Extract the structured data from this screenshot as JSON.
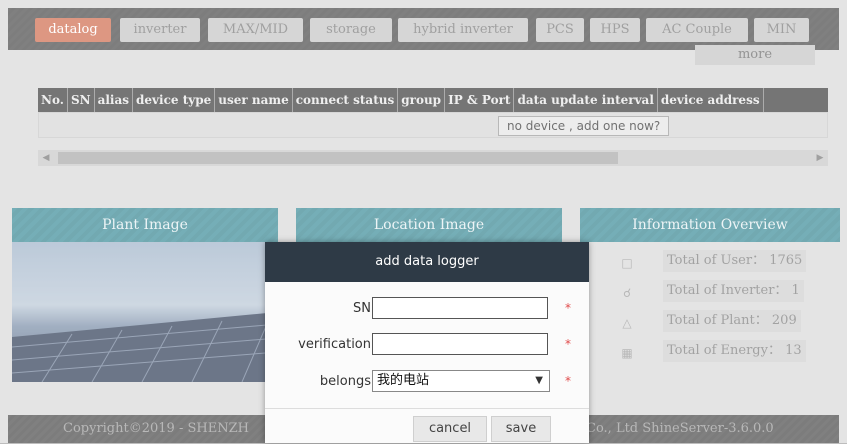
{
  "tabs": [
    {
      "label": "datalog",
      "active": true
    },
    {
      "label": "inverter"
    },
    {
      "label": "MAX/MID"
    },
    {
      "label": "storage"
    },
    {
      "label": "hybrid inverter"
    },
    {
      "label": "PCS"
    },
    {
      "label": "HPS"
    },
    {
      "label": "AC Couple"
    },
    {
      "label": "MIN"
    }
  ],
  "more_label": "more",
  "table": {
    "headers": [
      "No.",
      "SN",
      "alias",
      "device type",
      "user name",
      "connect status",
      "group",
      "IP & Port",
      "data update interval",
      "device address"
    ],
    "empty_action": "no device , add one now?"
  },
  "cards": {
    "plant_image": "Plant Image",
    "location_image": "Location Image",
    "information_overview": "Information Overview"
  },
  "overview": [
    {
      "label": "Total of User： 1765",
      "icon": "user-icon"
    },
    {
      "label": "Total of Inverter： 1",
      "icon": "inverter-icon"
    },
    {
      "label": "Total of Plant： 209",
      "icon": "plant-icon"
    },
    {
      "label": "Total of Energy： 13",
      "icon": "energy-icon"
    }
  ],
  "footer": {
    "left": "Copyright©2019 - SHENZH",
    "right": "Co., Ltd ShineServer-3.6.0.0"
  },
  "modal": {
    "title": "add data logger",
    "fields": {
      "sn_label": "SN",
      "sn_value": "",
      "verification_label": "verification",
      "verification_value": "",
      "belongs_label": "belongs",
      "belongs_value": "我的电站"
    },
    "required_mark": "*",
    "cancel": "cancel",
    "save": "save"
  },
  "colors": {
    "active_tab": "#cf6a4c",
    "card_header": "#3a8c98",
    "modal_header": "#2e3a46",
    "required": "#e04a4a"
  }
}
